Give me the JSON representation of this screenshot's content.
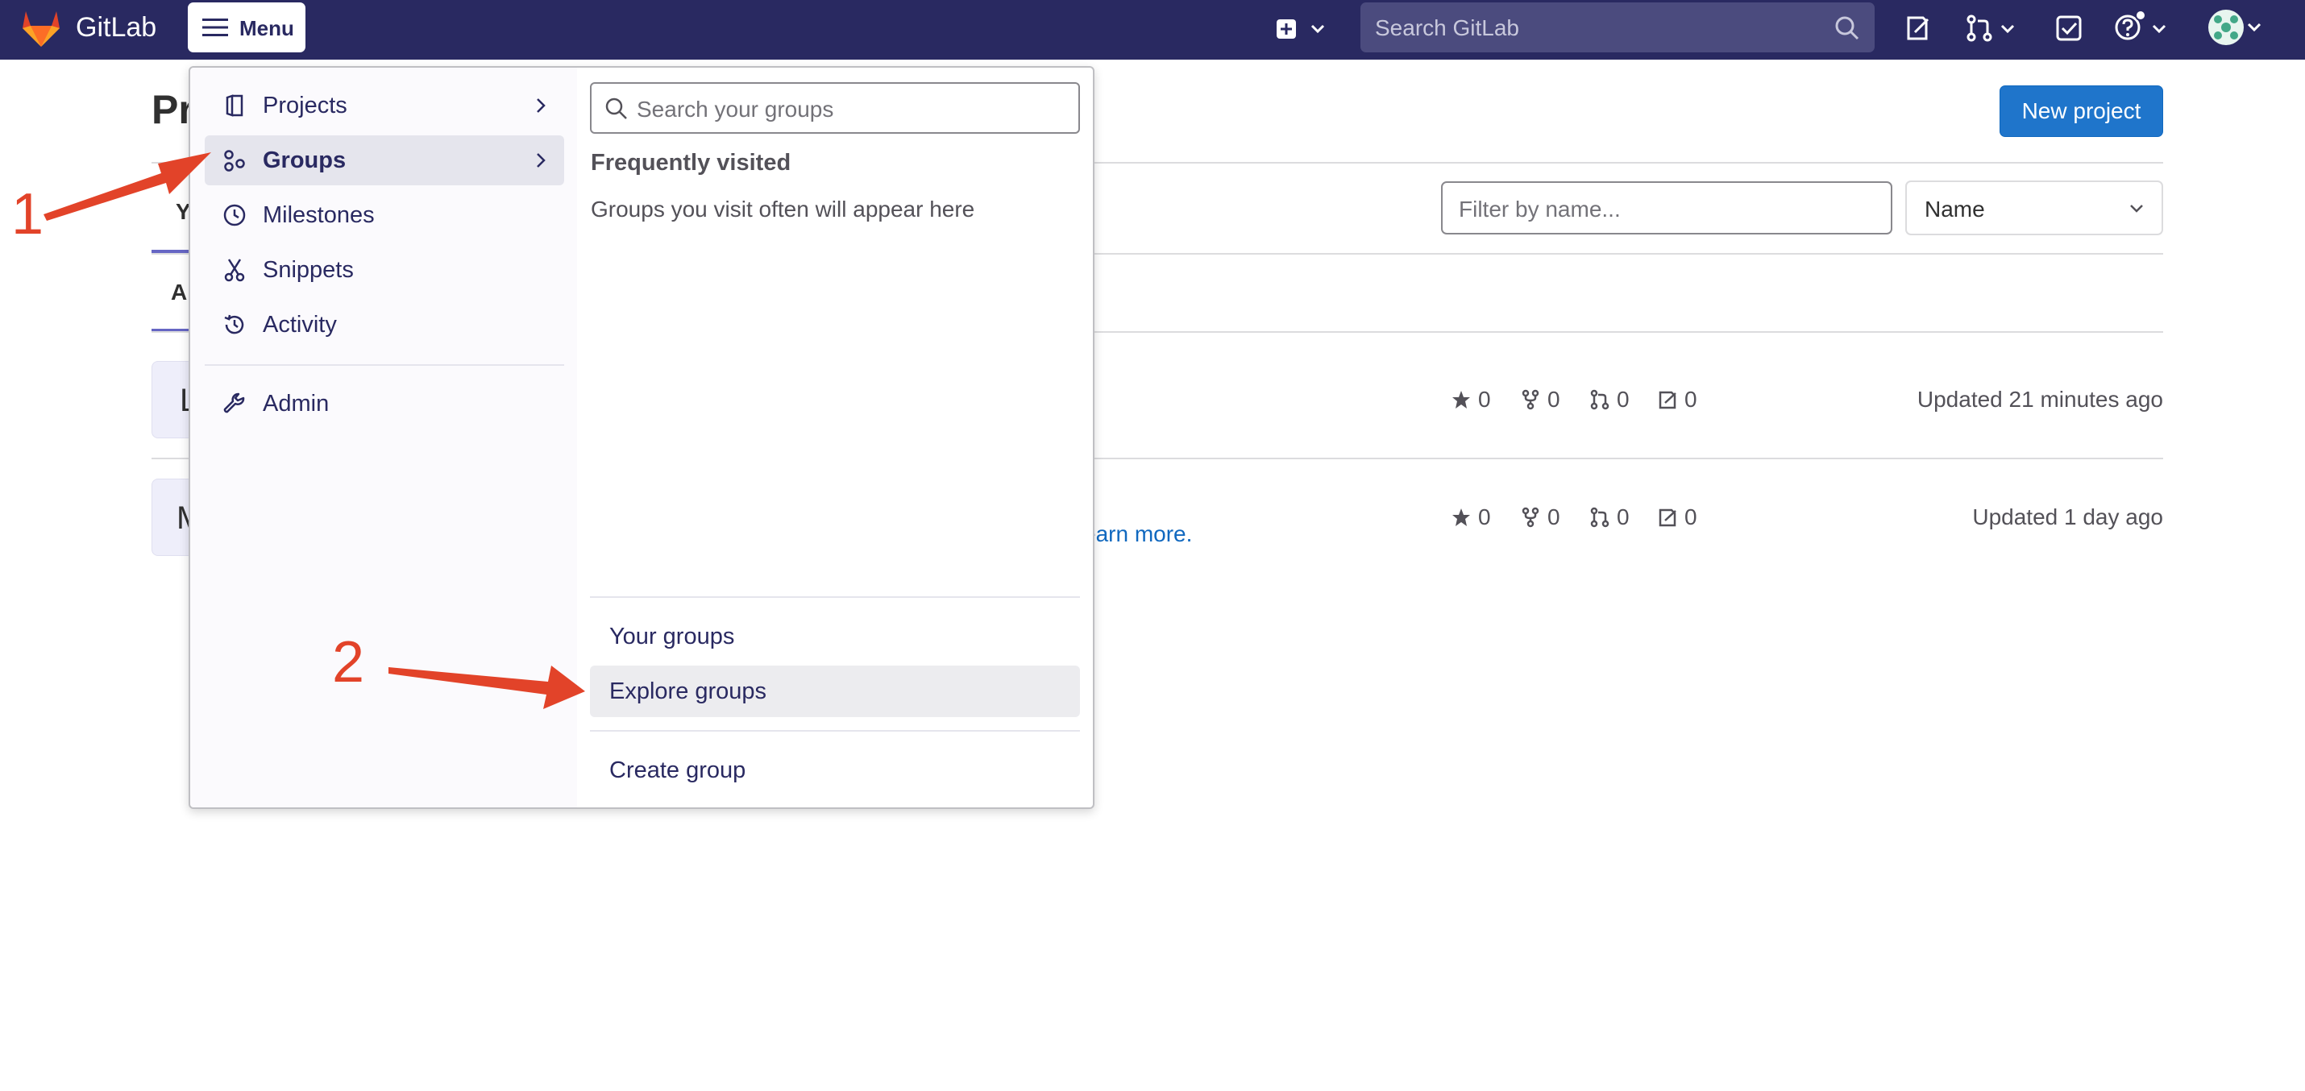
{
  "topbar": {
    "brand": "GitLab",
    "menu_label": "Menu",
    "search_placeholder": "Search GitLab"
  },
  "page": {
    "title_fragment": "Pr",
    "new_project_label": "New project",
    "filter_placeholder": "Filter by name...",
    "sort_value": "Name",
    "tab_fragments": [
      "Y",
      "Al"
    ],
    "rows": [
      {
        "avatar_fragment": "L",
        "stars": "0",
        "forks": "0",
        "mrs": "0",
        "issues": "0",
        "updated": "Updated 21 minutes ago"
      },
      {
        "avatar_fragment": "M",
        "stars": "0",
        "forks": "0",
        "mrs": "0",
        "issues": "0",
        "updated": "Updated 1 day ago",
        "link_fragment": "earn more."
      }
    ]
  },
  "menu": {
    "nav": [
      {
        "label": "Projects",
        "icon": "project-icon"
      },
      {
        "label": "Groups",
        "icon": "group-icon",
        "active": true
      },
      {
        "label": "Milestones",
        "icon": "clock-icon"
      },
      {
        "label": "Snippets",
        "icon": "scissors-icon"
      },
      {
        "label": "Activity",
        "icon": "history-icon"
      },
      {
        "label": "Admin",
        "icon": "wrench-icon"
      }
    ],
    "groups_panel": {
      "search_placeholder": "Search your groups",
      "frequent_title": "Frequently visited",
      "frequent_empty": "Groups you visit often will appear here",
      "links": [
        "Your groups",
        "Explore groups",
        "Create group"
      ]
    }
  },
  "annotations": {
    "step1": "1",
    "step2": "2",
    "color": "#e24329"
  }
}
